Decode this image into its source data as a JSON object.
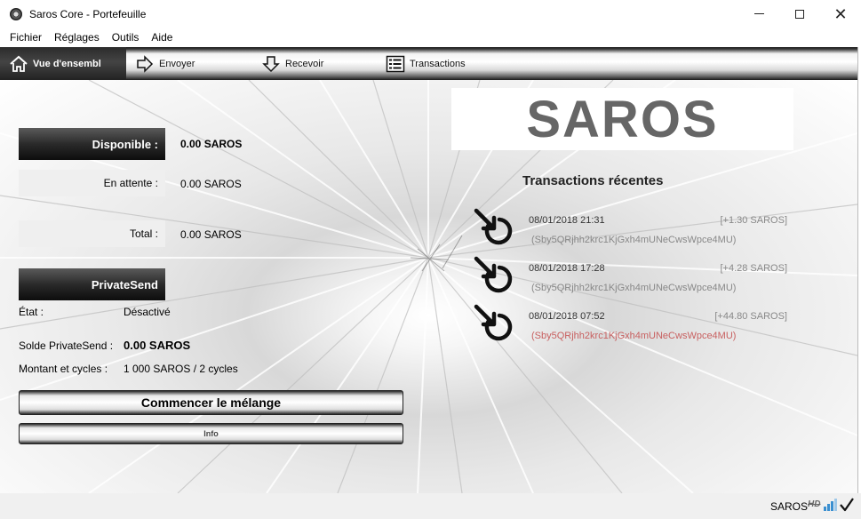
{
  "window": {
    "title": "Saros Core - Portefeuille",
    "icon": "app-coin-icon"
  },
  "menu": [
    "Fichier",
    "Réglages",
    "Outils",
    "Aide"
  ],
  "toolbar": {
    "tabs": [
      {
        "label": "Vue d'ensembl",
        "icon": "home-icon",
        "active": true
      },
      {
        "label": "Envoyer",
        "icon": "send-arrow-icon",
        "active": false
      },
      {
        "label": "Recevoir",
        "icon": "receive-arrow-icon",
        "active": false
      },
      {
        "label": "Transactions",
        "icon": "list-icon",
        "active": false
      }
    ]
  },
  "balances": {
    "available_label": "Disponible :",
    "available_value": "0.00 SAROS",
    "pending_label": "En attente :",
    "pending_value": "0.00 SAROS",
    "total_label": "Total :",
    "total_value": "0.00 SAROS"
  },
  "privatesend": {
    "header": "PrivateSend",
    "state_label": "État :",
    "state_value": "Désactivé",
    "balance_label": "Solde PrivateSend :",
    "balance_value": "0.00 SAROS",
    "amount_label": "Montant et cycles :",
    "amount_value": "1 000 SAROS / 2 cycles",
    "start_button": "Commencer le mélange",
    "info_button": "Info"
  },
  "logo_text": "SAROS",
  "recent": {
    "title": "Transactions récentes",
    "items": [
      {
        "date": "08/01/2018 21:31",
        "amount": "[+1.30 SAROS]",
        "address": "(Sby5QRjhh2krc1KjGxh4mUNeCwsWpce4MU)",
        "highlight": false
      },
      {
        "date": "08/01/2018 17:28",
        "amount": "[+4.28 SAROS]",
        "address": "(Sby5QRjhh2krc1KjGxh4mUNeCwsWpce4MU)",
        "highlight": false
      },
      {
        "date": "08/01/2018 07:52",
        "amount": "[+44.80 SAROS]",
        "address": "(Sby5QRjhh2krc1KjGxh4mUNeCwsWpce4MU)",
        "highlight": true
      }
    ]
  },
  "statusbar": {
    "unit": "SAROS",
    "hd": "HD"
  },
  "colors": {
    "address_highlight": "#c86060",
    "logo": "#666666"
  }
}
